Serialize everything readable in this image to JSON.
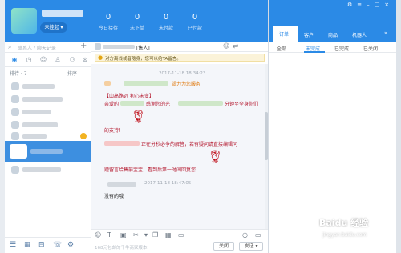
{
  "left": {
    "status": "未挂起",
    "search_placeholder": "联系人 / 聊天记录",
    "add_icon": "+",
    "sort_label": "排待 · 7",
    "sort_right": "排序",
    "icons": [
      "chat-icon",
      "clock-icon",
      "user-icon",
      "group-icon",
      "team-icon",
      "network-icon"
    ]
  },
  "stats": [
    {
      "value": "0",
      "label": "今日接待"
    },
    {
      "value": "0",
      "label": "未下单"
    },
    {
      "value": "0",
      "label": "未付款"
    },
    {
      "value": "0",
      "label": "已付款"
    }
  ],
  "chat": {
    "contact_suffix": "[售人]",
    "notice": "对方离线或者隐身，您可以给TA留言。",
    "timestamp_1": "2017-11-18 18:34:23",
    "line_1_right": "竭力为您服务",
    "line_2": "【山高路远 初心未变】",
    "line_3_left": "亲爱的",
    "line_3_mid": "感谢您的光",
    "line_3_right": "分钟至全身你们",
    "line_4": "的支持！",
    "line_5": "正在分秒必争的解答，若有疑问请直接编辑问",
    "line_6": "题留言给售前宝宝，看到后第一时间回复您",
    "timestamp_2": "2017-11-18 18:47:05",
    "reply": "没有的哦",
    "input_hint": "168元包邮的千牛商家版本",
    "close": "关闭",
    "send": "发送"
  },
  "right": {
    "tabs": [
      "订单",
      "客户",
      "商品",
      "机器人"
    ],
    "active_tab": "订单",
    "order_tabs": [
      "全部",
      "未完成",
      "已完成",
      "已关闭"
    ],
    "active_order_tab": "未完成"
  },
  "watermark": {
    "main": "Baidu 经验",
    "sub": "jingyan.baidu.com"
  }
}
